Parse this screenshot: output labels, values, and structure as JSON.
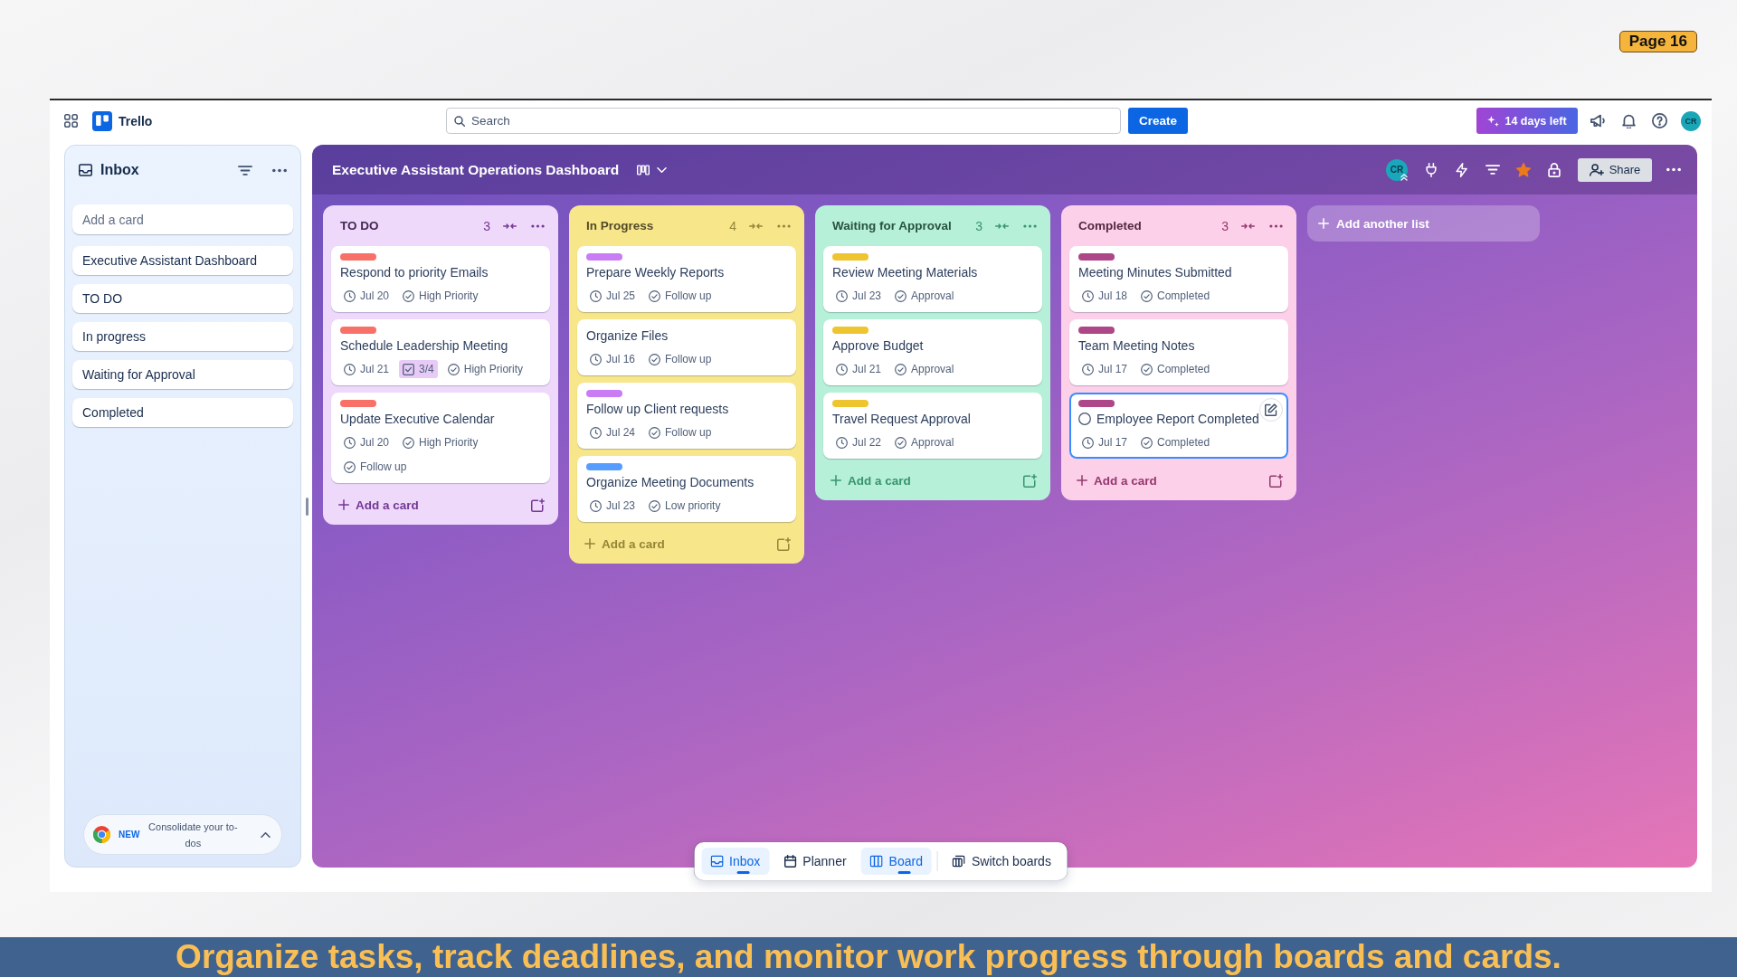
{
  "slide": {
    "page_badge": "Page 16",
    "caption": "Organize tasks, track deadlines, and monitor work progress through boards and cards."
  },
  "topbar": {
    "app_name": "Trello",
    "search": {
      "placeholder": "Search"
    },
    "create_button": "Create",
    "trial_button": "14 days left",
    "avatar": "CR"
  },
  "sidebar": {
    "title": "Inbox",
    "add_card": {
      "placeholder": "Add a card"
    },
    "items": [
      "Executive Assistant Dashboard",
      "TO DO",
      "In progress",
      "Waiting for Approval",
      "Completed"
    ],
    "promo": {
      "badge": "NEW",
      "text": "Consolidate your to-dos"
    }
  },
  "board": {
    "title": "Executive Assistant Operations Dashboard",
    "avatar": "CR",
    "starred": true,
    "share_button": "Share",
    "lists": [
      {
        "title": "TO DO",
        "count": "3",
        "color": "#efd9fb",
        "add_card": "Add a card",
        "cards": [
          {
            "title": "Respond to priority Emails",
            "color": "#f87168",
            "selected": false,
            "badges": [
              {
                "kind": "due",
                "text": "Jul 20"
              },
              {
                "kind": "tag",
                "text": "High Priority"
              }
            ]
          },
          {
            "title": "Schedule Leadership Meeting",
            "color": "#f87168",
            "selected": false,
            "badges": [
              {
                "kind": "due",
                "text": "Jul 21"
              },
              {
                "kind": "checklist",
                "text": "3/4"
              },
              {
                "kind": "tag",
                "text": "High Priority"
              }
            ]
          },
          {
            "title": "Update Executive Calendar",
            "color": "#f87168",
            "selected": false,
            "badges": [
              {
                "kind": "due",
                "text": "Jul 20"
              },
              {
                "kind": "tag",
                "text": "High Priority"
              },
              {
                "kind": "tag",
                "text": "Follow up"
              }
            ]
          }
        ]
      },
      {
        "title": "In Progress",
        "count": "4",
        "color": "#f8e68a",
        "add_card": "Add a card",
        "cards": [
          {
            "title": "Prepare Weekly Reports",
            "color": "#c97cf4",
            "selected": false,
            "badges": [
              {
                "kind": "due",
                "text": "Jul 25"
              },
              {
                "kind": "tag",
                "text": "Follow up"
              }
            ]
          },
          {
            "title": "Organize Files",
            "selected": false,
            "badges": [
              {
                "kind": "due",
                "text": "Jul 16"
              },
              {
                "kind": "tag",
                "text": "Follow up"
              }
            ]
          },
          {
            "title": "Follow up Client requests",
            "color": "#c97cf4",
            "selected": false,
            "badges": [
              {
                "kind": "due",
                "text": "Jul 24"
              },
              {
                "kind": "tag",
                "text": "Follow up"
              }
            ]
          },
          {
            "title": "Organize Meeting Documents",
            "color": "#579dff",
            "selected": false,
            "badges": [
              {
                "kind": "due",
                "text": "Jul 23"
              },
              {
                "kind": "tag",
                "text": "Low priority"
              }
            ]
          }
        ]
      },
      {
        "title": "Waiting for Approval",
        "count": "3",
        "color": "#b6f0d8",
        "add_card": "Add a card",
        "cards": [
          {
            "title": "Review Meeting Materials",
            "color": "#eec52e",
            "selected": false,
            "badges": [
              {
                "kind": "due",
                "text": "Jul 23"
              },
              {
                "kind": "tag",
                "text": "Approval"
              }
            ]
          },
          {
            "title": "Approve Budget",
            "color": "#eec52e",
            "selected": false,
            "badges": [
              {
                "kind": "due",
                "text": "Jul 21"
              },
              {
                "kind": "tag",
                "text": "Approval"
              }
            ]
          },
          {
            "title": "Travel Request Approval",
            "color": "#eec52e",
            "selected": false,
            "badges": [
              {
                "kind": "due",
                "text": "Jul 22"
              },
              {
                "kind": "tag",
                "text": "Approval"
              }
            ]
          }
        ]
      },
      {
        "title": "Completed",
        "count": "3",
        "color": "#fdd0ea",
        "add_card": "Add a card",
        "cards": [
          {
            "title": "Meeting Minutes Submitted",
            "color": "#ae4787",
            "selected": false,
            "badges": [
              {
                "kind": "due",
                "text": "Jul 18"
              },
              {
                "kind": "tag",
                "text": "Completed"
              }
            ]
          },
          {
            "title": "Team Meeting Notes",
            "color": "#ae4787",
            "selected": false,
            "badges": [
              {
                "kind": "due",
                "text": "Jul 17"
              },
              {
                "kind": "tag",
                "text": "Completed"
              }
            ]
          },
          {
            "title": "Employee Report Completed",
            "color": "#ae4787",
            "selected": true,
            "badges": [
              {
                "kind": "due",
                "text": "Jul 17"
              },
              {
                "kind": "tag",
                "text": "Completed"
              }
            ]
          }
        ]
      }
    ],
    "add_list": "Add another list"
  },
  "bottom_nav": [
    {
      "label": "Inbox",
      "kind": "inbox",
      "selected": true
    },
    {
      "label": "Planner",
      "kind": "planner",
      "selected": false
    },
    {
      "label": "Board",
      "kind": "board",
      "selected": true
    },
    {
      "label": "Switch boards",
      "kind": "switch",
      "selected": false
    }
  ]
}
